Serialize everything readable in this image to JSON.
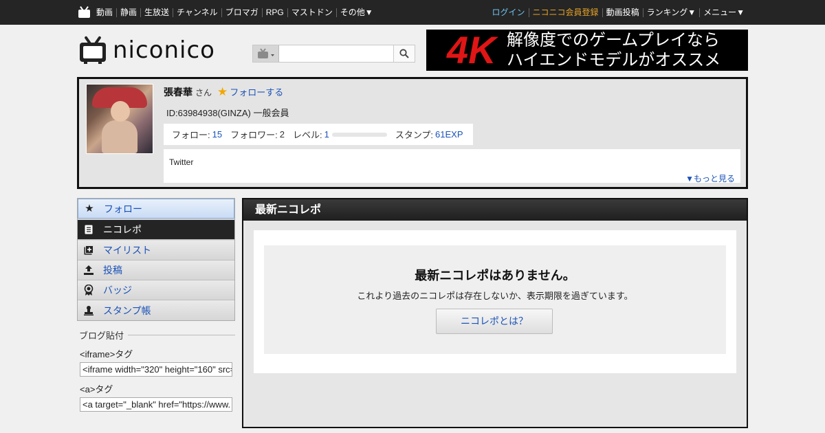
{
  "topnav": {
    "left": [
      "動画",
      "静画",
      "生放送",
      "チャンネル",
      "ブロマガ",
      "RPG",
      "マストドン",
      "その他▼"
    ],
    "login": "ログイン",
    "premium": "ニコニコ会員登録",
    "upload": "動画投稿",
    "ranking": "ランキング▼",
    "menu": "メニュー▼"
  },
  "header": {
    "logo_text": "niconico",
    "search_placeholder": ""
  },
  "ad": {
    "big": "4K",
    "line1": "解像度でのゲームプレイなら",
    "line2": "ハイエンドモデルがオススメ"
  },
  "profile": {
    "name": "張春華",
    "honorific": "さん",
    "follow_label": "フォローする",
    "id_line": "ID:63984938(GINZA) 一般会員",
    "follow_count_label": "フォロー:",
    "follow_count": "15",
    "follower_label": "フォロワー:",
    "follower_count": "2",
    "level_label": "レベル:",
    "level": "1",
    "level_progress": 0,
    "stamp_label": "スタンプ:",
    "stamp_value": "61EXP",
    "description": "Twitter",
    "more_label": "▼もっと見る"
  },
  "sidemenu": [
    {
      "label": "フォロー",
      "icon": "star-icon"
    },
    {
      "label": "ニコレポ",
      "icon": "document-icon"
    },
    {
      "label": "マイリスト",
      "icon": "mylist-icon"
    },
    {
      "label": "投稿",
      "icon": "upload-icon"
    },
    {
      "label": "バッジ",
      "icon": "badge-icon"
    },
    {
      "label": "スタンプ帳",
      "icon": "stamp-icon"
    }
  ],
  "blog": {
    "heading": "ブログ貼付",
    "iframe_label": "<iframe>タグ",
    "iframe_code": "<iframe width=\"320\" height=\"160\" src=",
    "a_label": "<a>タグ",
    "a_code": "<a target=\"_blank\" href=\"https://www."
  },
  "main": {
    "title": "最新ニコレポ",
    "empty_heading": "最新ニコレポはありません。",
    "empty_sub": "これより過去のニコレポは存在しないか、表示期限を過ぎています。",
    "help_button": "ニコレポとは？"
  },
  "colors": {
    "topbar": "#252525",
    "link": "#1a52b8",
    "login": "#6fc3f0",
    "premium": "#e6a328",
    "ad_red": "#e01515"
  }
}
